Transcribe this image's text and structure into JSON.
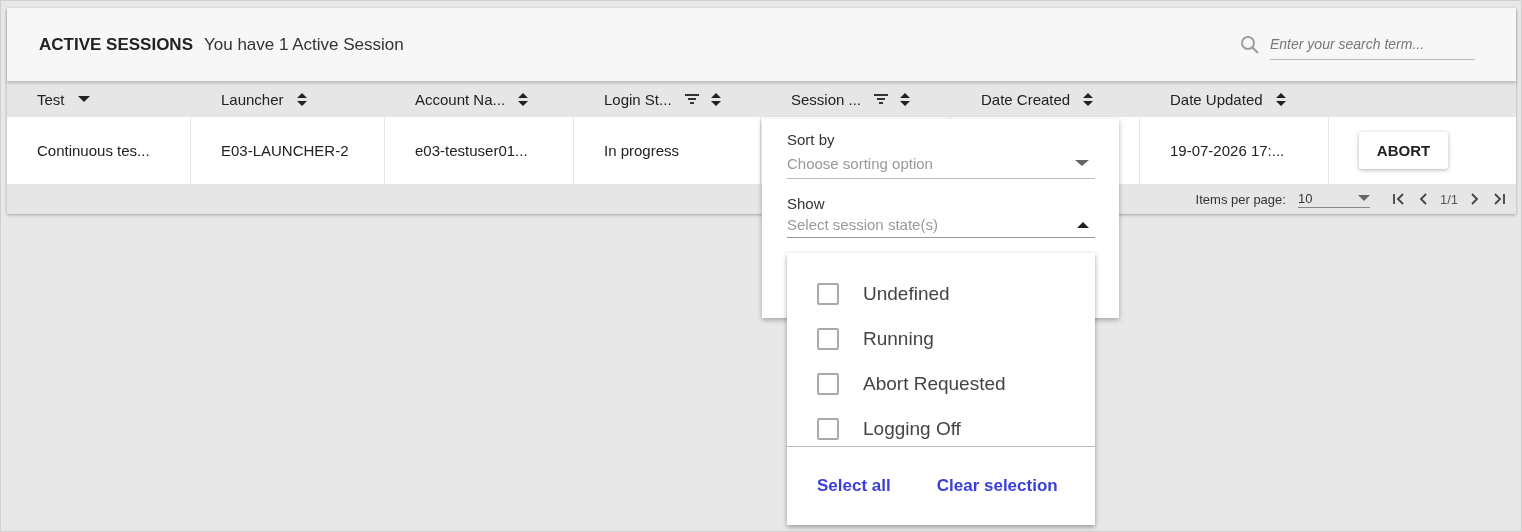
{
  "header": {
    "title": "ACTIVE SESSIONS",
    "subtitle": "You have 1 Active Session",
    "search": {
      "placeholder": "Enter your search term..."
    }
  },
  "table": {
    "columns": [
      {
        "label": "Test",
        "kind": "sorted",
        "filter": false
      },
      {
        "label": "Launcher",
        "kind": "sortable",
        "filter": false
      },
      {
        "label": "Account Na...",
        "kind": "sortable",
        "filter": false
      },
      {
        "label": "Login St...",
        "kind": "sortable",
        "filter": true
      },
      {
        "label": "Session ...",
        "kind": "sortable",
        "filter": true
      },
      {
        "label": "Date Created",
        "kind": "sortable",
        "filter": false
      },
      {
        "label": "Date Updated",
        "kind": "sortable",
        "filter": false
      }
    ],
    "rows": [
      {
        "cells": [
          "Continuous tes...",
          "E03-LAUNCHER-2",
          "e03-testuser01...",
          "In progress",
          null,
          null,
          "19-07-2026 17:..."
        ],
        "action": "ABORT"
      }
    ]
  },
  "pagination": {
    "label": "Items per page:",
    "page_size": "10",
    "range": "1/1"
  },
  "filter_panel": {
    "sort_by": {
      "label": "Sort by",
      "placeholder": "Choose sorting option"
    },
    "show": {
      "label": "Show",
      "placeholder": "Select session state(s)",
      "expanded": true
    },
    "options": [
      {
        "label": "Undefined",
        "checked": false
      },
      {
        "label": "Running",
        "checked": false
      },
      {
        "label": "Abort Requested",
        "checked": false
      },
      {
        "label": "Logging Off",
        "checked": false
      }
    ],
    "actions": [
      "Select all",
      "Clear selection"
    ]
  }
}
